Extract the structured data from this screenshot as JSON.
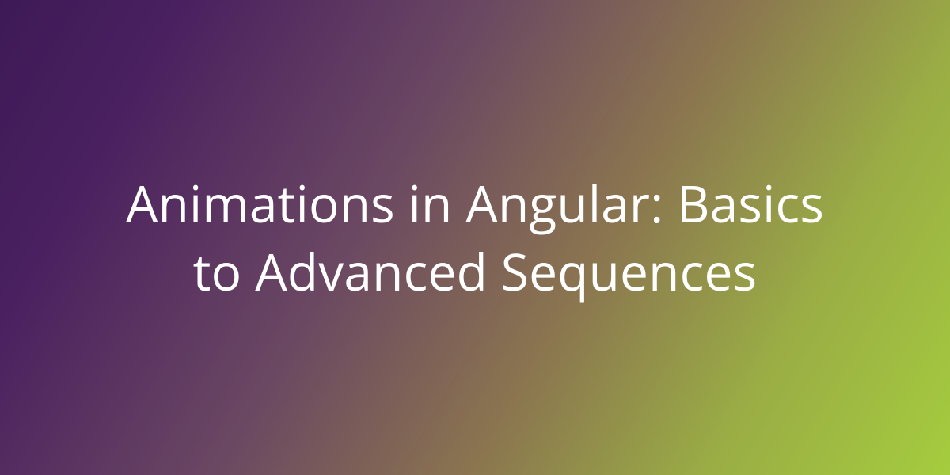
{
  "hero": {
    "title": "Animations in Angular: Basics to Advanced Sequences"
  },
  "colors": {
    "gradient_start": "#3d1a56",
    "gradient_end": "#a5cc3e",
    "text": "#ffffff"
  }
}
